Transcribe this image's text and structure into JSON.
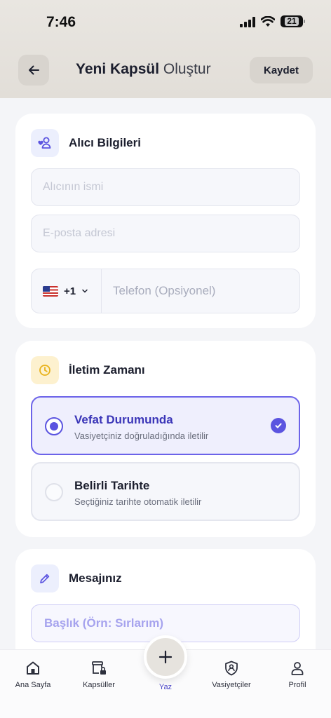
{
  "status": {
    "time": "7:46",
    "battery": "21"
  },
  "header": {
    "title_bold": "Yeni Kapsül",
    "title_light": "Oluştur",
    "save_label": "Kaydet"
  },
  "recipient": {
    "title": "Alıcı Bilgileri",
    "name_placeholder": "Alıcının ismi",
    "email_placeholder": "E-posta adresi",
    "country_code": "+1",
    "phone_placeholder": "Telefon (Opsiyonel)"
  },
  "delivery": {
    "title": "İletim Zamanı",
    "options": [
      {
        "title": "Vefat Durumunda",
        "subtitle": "Vasiyetçiniz doğruladığında iletilir",
        "selected": true
      },
      {
        "title": "Belirli Tarihte",
        "subtitle": "Seçtiğiniz tarihte otomatik iletilir",
        "selected": false
      }
    ]
  },
  "message": {
    "title": "Mesajınız",
    "title_placeholder": "Başlık (Örn: Sırlarım)"
  },
  "nav": {
    "items": [
      {
        "label": "Ana Sayfa",
        "icon": "home-icon"
      },
      {
        "label": "Kapsüller",
        "icon": "capsule-lock-icon"
      },
      {
        "label": "Yaz",
        "icon": "plus-icon"
      },
      {
        "label": "Vasiyetçiler",
        "icon": "shield-user-icon"
      },
      {
        "label": "Profil",
        "icon": "user-icon"
      }
    ]
  },
  "colors": {
    "accent": "#5b54e0",
    "selected_bg": "#efeffd",
    "clock_icon": "#e8b21a"
  }
}
